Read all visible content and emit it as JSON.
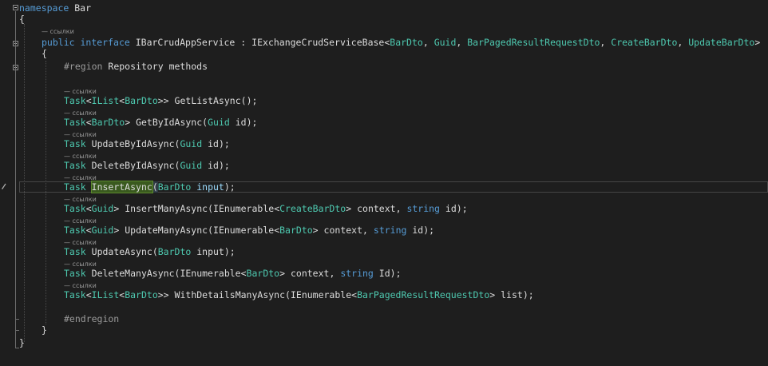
{
  "code": {
    "namespace_kw": "namespace",
    "namespace_name": "Bar",
    "open_brace": "{",
    "close_brace": "}",
    "lens_text": "— ссылки",
    "iface_public": "public",
    "iface_interface": "interface",
    "iface_name": "IBarCrudAppService",
    "iface_colon": ":",
    "iface_base": "IExchangeCrudServiceBase",
    "iface_lt": "<",
    "iface_arg1": "BarDto",
    "iface_arg2": "Guid",
    "iface_arg3": "BarPagedResultRequestDto",
    "iface_arg4": "CreateBarDto",
    "iface_arg5": "UpdateBarDto",
    "iface_gt": ">",
    "region_kw": "#region",
    "region_name": "Repository methods",
    "endregion_kw": "#endregion",
    "m1": {
      "task": "Task",
      "lt": "<",
      "ilist": "IList",
      "lt2": "<",
      "arg": "BarDto",
      "gt": ">>",
      "name": "GetListAsync",
      "rest": "();"
    },
    "m2": {
      "task": "Task",
      "lt": "<",
      "arg": "BarDto",
      "gt": ">",
      "name": "GetByIdAsync",
      "open": "(",
      "ptype": "Guid",
      "pname": "id",
      "close": ");"
    },
    "m3": {
      "task": "Task",
      "name": "UpdateByIdAsync",
      "open": "(",
      "ptype": "Guid",
      "pname": "id",
      "close": ");"
    },
    "m4": {
      "task": "Task",
      "name": "DeleteByIdAsync",
      "open": "(",
      "ptype": "Guid",
      "pname": "id",
      "close": ");"
    },
    "m5": {
      "task": "Task",
      "name": "InsertAsync",
      "open": "(",
      "ptype": "BarDto",
      "pname": "input",
      "close": ");"
    },
    "m6": {
      "task": "Task",
      "lt": "<",
      "targ": "Guid",
      "gt": ">",
      "name": "InsertManyAsync",
      "open": "(",
      "ptype": "IEnumerable",
      "plt": "<",
      "parg": "CreateBarDto",
      "pgt": ">",
      "pname": "context",
      "comma": ",",
      "p2type": "string",
      "p2name": "id",
      "close": ");"
    },
    "m7": {
      "task": "Task",
      "lt": "<",
      "targ": "Guid",
      "gt": ">",
      "name": "UpdateManyAsync",
      "open": "(",
      "ptype": "IEnumerable",
      "plt": "<",
      "parg": "BarDto",
      "pgt": ">",
      "pname": "context",
      "comma": ",",
      "p2type": "string",
      "p2name": "id",
      "close": ");"
    },
    "m8": {
      "task": "Task",
      "name": "UpdateAsync",
      "open": "(",
      "ptype": "BarDto",
      "pname": "input",
      "close": ");"
    },
    "m9": {
      "task": "Task",
      "name": "DeleteManyAsync",
      "open": "(",
      "ptype": "IEnumerable",
      "plt": "<",
      "parg": "BarDto",
      "pgt": ">",
      "pname": "context",
      "comma": ",",
      "p2type": "string",
      "p2name": "Id",
      "close": ");"
    },
    "m10": {
      "task": "Task",
      "lt": "<",
      "ilist": "IList",
      "lt2": "<",
      "arg": "BarDto",
      "gt": ">>",
      "name": "WithDetailsManyAsync",
      "open": "(",
      "ptype": "IEnumerable",
      "plt": "<",
      "parg": "BarPagedResultRequestDto",
      "pgt": ">",
      "pname": "list",
      "close": ");"
    }
  },
  "colors": {
    "background": "#1e1e1e",
    "keyword": "#569cd6",
    "type": "#4ec9b0",
    "parameter": "#9cdcfe",
    "text": "#dcdcdc",
    "region": "#9b9b9b",
    "lens": "#999999",
    "selection_highlight": "#3a5a1f"
  },
  "icons": {
    "fold": "fold-minus-icon",
    "edit": "pencil-edit-icon"
  }
}
